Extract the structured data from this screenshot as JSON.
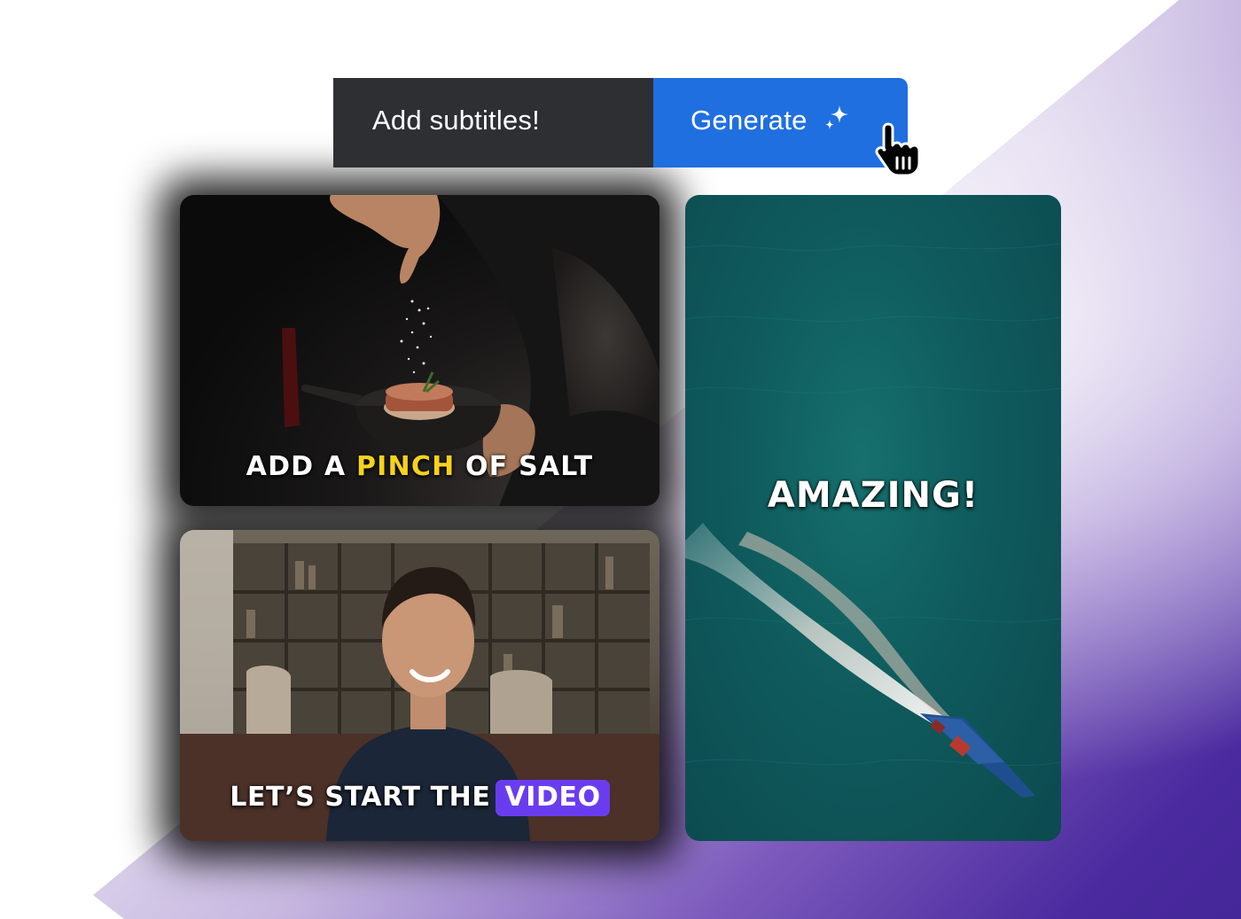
{
  "prompt": {
    "input_text": "Add subtitles!",
    "button_label": "Generate",
    "button_icon": "sparkle-icon",
    "cursor_icon": "hand-pointer-icon"
  },
  "colors": {
    "button": "#1f6fe0",
    "input": "#2e2f33",
    "yellow_highlight": "#f5d21c",
    "purple_highlight": "#6a3cf0",
    "backdrop": "#452799"
  },
  "videos": [
    {
      "scene": "chef-salting-pan",
      "caption_before": "ADD A ",
      "caption_highlight": "PINCH",
      "caption_after": " OF SALT"
    },
    {
      "scene": "woman-speaking",
      "caption_before": "LET’S START THE",
      "caption_highlight": "VIDEO"
    },
    {
      "scene": "boat-on-sea",
      "caption": "AMAZING!"
    }
  ]
}
